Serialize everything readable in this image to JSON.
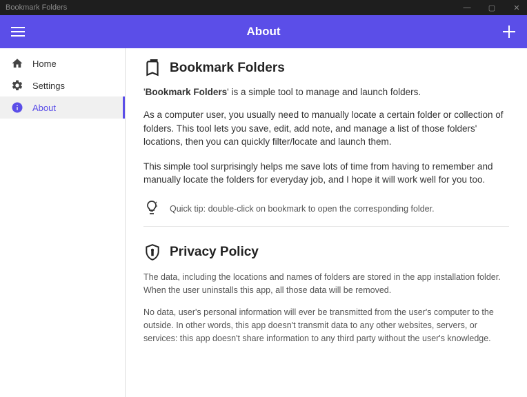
{
  "window": {
    "title": "Bookmark Folders"
  },
  "appbar": {
    "title": "About"
  },
  "sidebar": {
    "items": [
      {
        "label": "Home"
      },
      {
        "label": "Settings"
      },
      {
        "label": "About"
      }
    ]
  },
  "main": {
    "section1": {
      "title": "Bookmark Folders",
      "intro_prefix": "'",
      "intro_bold": "Bookmark Folders",
      "intro_suffix": "' is a simple tool to manage and launch folders.",
      "para1": "As a computer user, you usually need to manually locate a certain folder or collection of folders. This tool lets you save, edit, add note, and manage a list of those folders' locations, then you can quickly filter/locate and launch them.",
      "para2": "This simple tool surprisingly helps me save lots of time from having to remember and manually locate the folders for everyday job, and I hope it will work well for you too.",
      "tip": "Quick tip: double-click on bookmark to open the corresponding folder."
    },
    "section2": {
      "title": "Privacy Policy",
      "para1": "The data, including the locations and names of folders are stored in the app installation folder. When the user uninstalls this app, all those data will be removed.",
      "para2": "No data, user's personal information will ever be transmitted from the user's computer to the outside. In other words, this app doesn't transmit data to any other websites, servers, or services: this app doesn't share information to any third party without the user's knowledge."
    }
  }
}
